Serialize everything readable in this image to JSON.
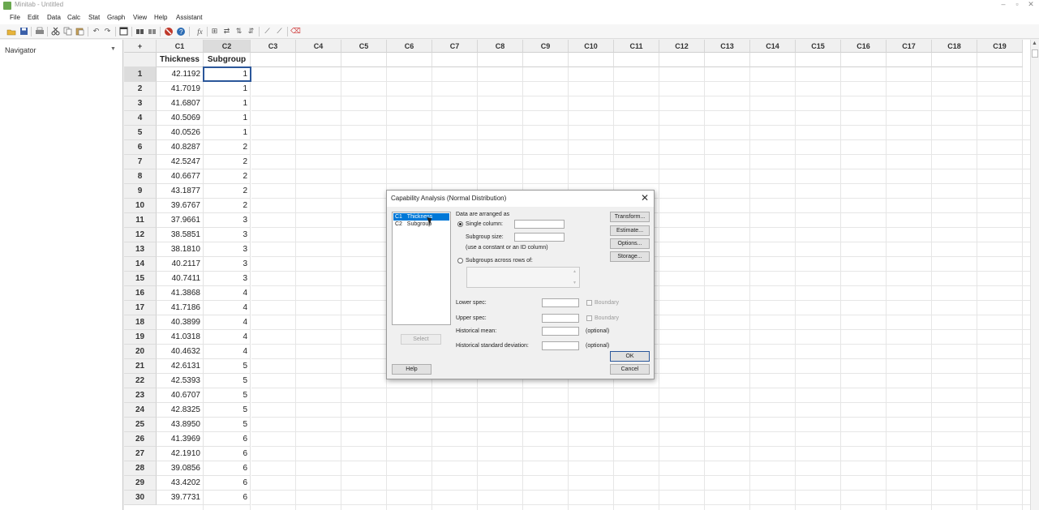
{
  "window": {
    "title": "Minitab - Untitled",
    "minimize": "–",
    "restore": "▫",
    "close": "✕"
  },
  "menu": [
    "File",
    "Edit",
    "Data",
    "Calc",
    "Stat",
    "Graph",
    "View",
    "Help",
    "Assistant"
  ],
  "navigator": {
    "title": "Navigator",
    "arrow": "▼"
  },
  "worksheet": {
    "corner": "+",
    "columns": [
      "C1",
      "C2",
      "C3",
      "C4",
      "C5",
      "C6",
      "C7",
      "C8",
      "C9",
      "C10",
      "C11",
      "C12",
      "C13",
      "C14",
      "C15",
      "C16",
      "C17",
      "C18",
      "C19"
    ],
    "names": [
      "Thickness",
      "Subgroup"
    ],
    "rows": [
      [
        "1",
        "42.1192",
        "1"
      ],
      [
        "2",
        "41.7019",
        "1"
      ],
      [
        "3",
        "41.6807",
        "1"
      ],
      [
        "4",
        "40.5069",
        "1"
      ],
      [
        "5",
        "40.0526",
        "1"
      ],
      [
        "6",
        "40.8287",
        "2"
      ],
      [
        "7",
        "42.5247",
        "2"
      ],
      [
        "8",
        "40.6677",
        "2"
      ],
      [
        "9",
        "43.1877",
        "2"
      ],
      [
        "10",
        "39.6767",
        "2"
      ],
      [
        "11",
        "37.9661",
        "3"
      ],
      [
        "12",
        "38.5851",
        "3"
      ],
      [
        "13",
        "38.1810",
        "3"
      ],
      [
        "14",
        "40.2117",
        "3"
      ],
      [
        "15",
        "40.7411",
        "3"
      ],
      [
        "16",
        "41.3868",
        "4"
      ],
      [
        "17",
        "41.7186",
        "4"
      ],
      [
        "18",
        "40.3899",
        "4"
      ],
      [
        "19",
        "41.0318",
        "4"
      ],
      [
        "20",
        "40.4632",
        "4"
      ],
      [
        "21",
        "42.6131",
        "5"
      ],
      [
        "22",
        "42.5393",
        "5"
      ],
      [
        "23",
        "40.6707",
        "5"
      ],
      [
        "24",
        "42.8325",
        "5"
      ],
      [
        "25",
        "43.8950",
        "5"
      ],
      [
        "26",
        "41.3969",
        "6"
      ],
      [
        "27",
        "42.1910",
        "6"
      ],
      [
        "28",
        "39.0856",
        "6"
      ],
      [
        "29",
        "43.4202",
        "6"
      ],
      [
        "30",
        "39.7731",
        "6"
      ]
    ]
  },
  "dialog": {
    "title": "Capability Analysis (Normal Distribution)",
    "close": "✕",
    "variables": [
      {
        "id": "C1",
        "name": "Thickness"
      },
      {
        "id": "C2",
        "name": "Subgroup"
      }
    ],
    "arranged_label": "Data are arranged as",
    "single_column": "Single column:",
    "subgroup_size": "Subgroup size:",
    "subgroup_hint": "(use a constant or an ID column)",
    "across_rows": "Subgroups across rows of:",
    "lower_spec": "Lower spec:",
    "upper_spec": "Upper spec:",
    "boundary": "Boundary",
    "hist_mean": "Historical mean:",
    "hist_sd": "Historical standard deviation:",
    "optional": "(optional)",
    "buttons": {
      "transform": "Transform...",
      "estimate": "Estimate...",
      "options": "Options...",
      "storage": "Storage...",
      "select": "Select",
      "help": "Help",
      "ok": "OK",
      "cancel": "Cancel"
    }
  },
  "colors": {
    "selection": "#0078d7",
    "active_cell_border": "#2b579a",
    "stop_icon": "#c0392b",
    "help_icon": "#2e6db4"
  }
}
